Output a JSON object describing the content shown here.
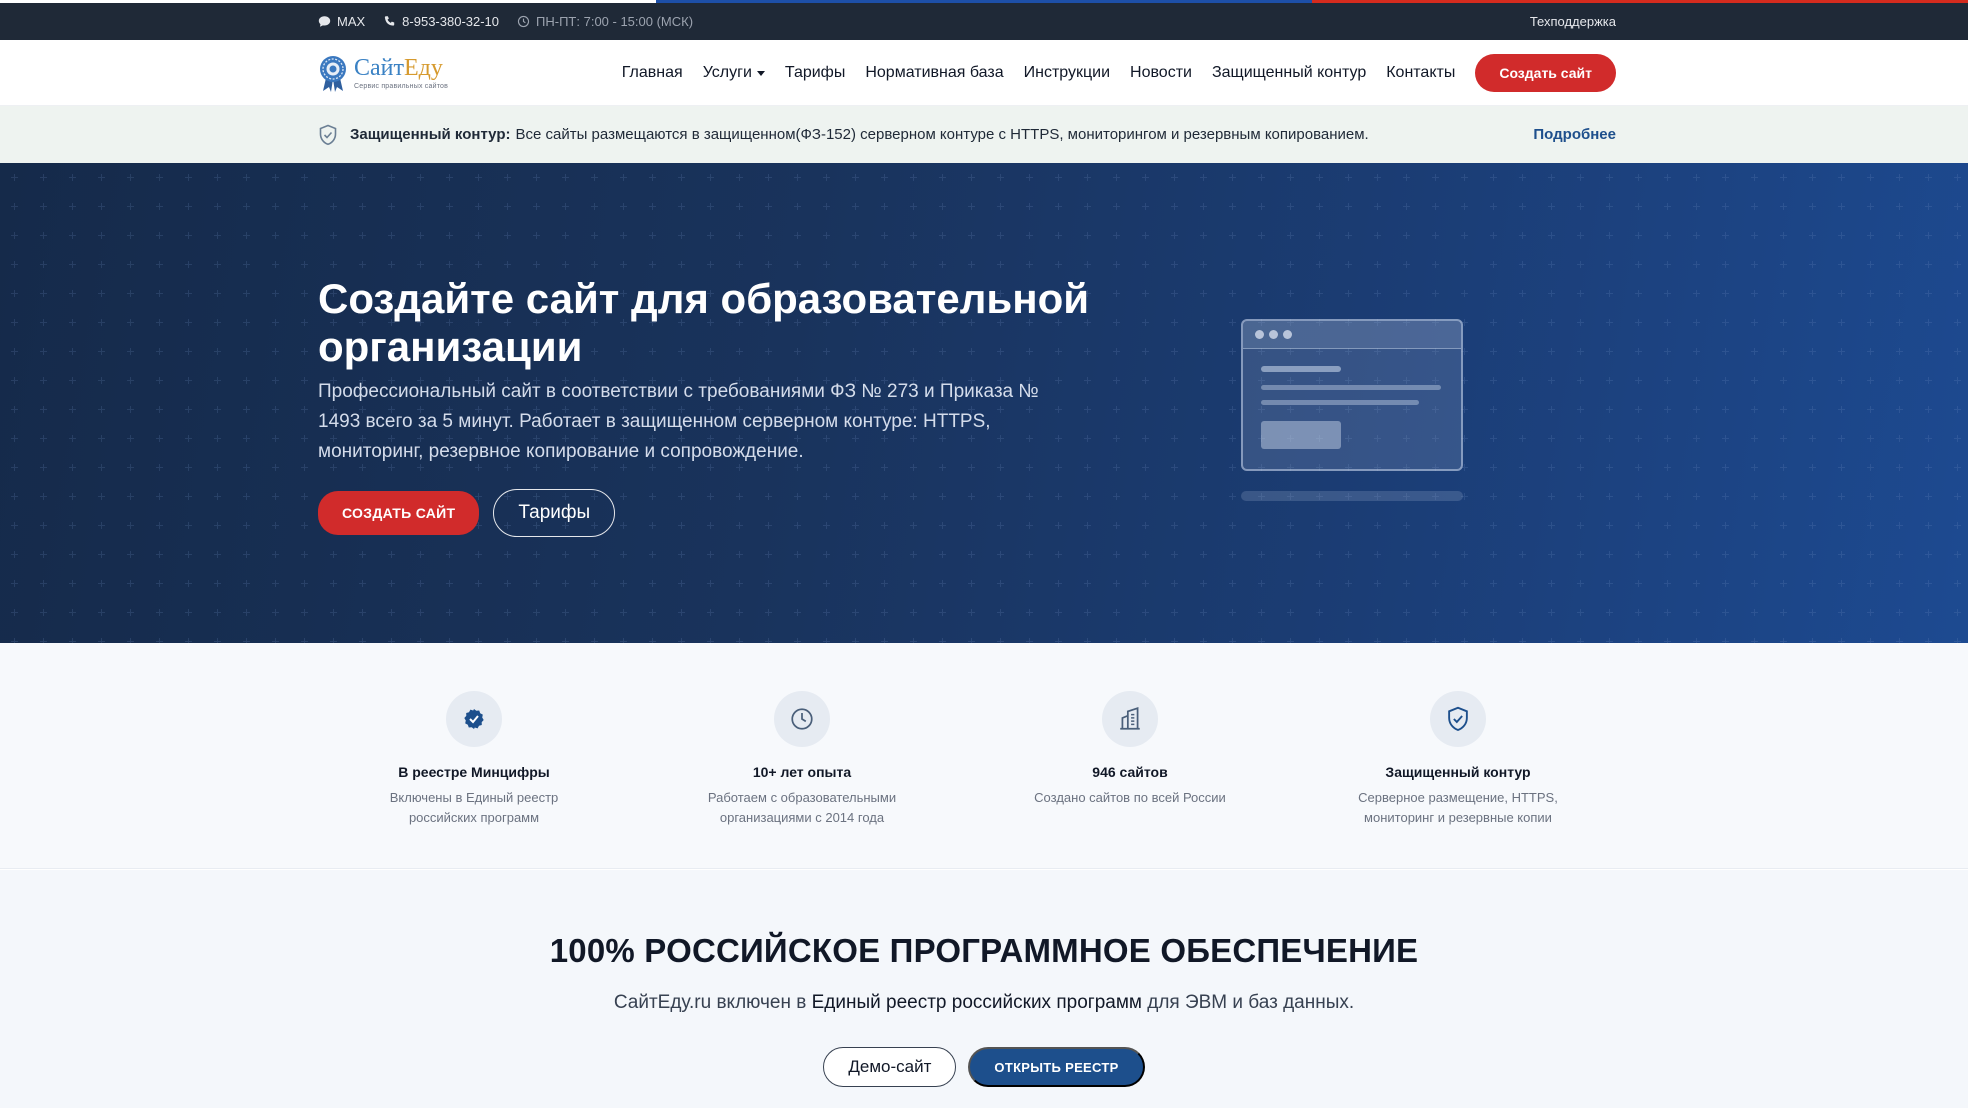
{
  "topbar": {
    "messenger": "MAX",
    "phone": "8-953-380-32-10",
    "hours": "ПН-ПТ: 7:00 - 15:00 (МСК)",
    "support": "Техподдержка"
  },
  "header": {
    "logo_name_a": "Сайт",
    "logo_name_b": "Еду",
    "logo_tagline": "Сервис правильных сайтов",
    "nav": [
      {
        "label": "Главная"
      },
      {
        "label": "Услуги"
      },
      {
        "label": "Тарифы"
      },
      {
        "label": "Нормативная база"
      },
      {
        "label": "Инструкции"
      },
      {
        "label": "Новости"
      },
      {
        "label": "Защищенный контур"
      },
      {
        "label": "Контакты"
      }
    ],
    "cta": "Создать сайт"
  },
  "notice": {
    "title": "Защищенный контур:",
    "text": "Все сайты размещаются в защищенном(ФЗ-152) серверном контуре с HTTPS, мониторингом и резервным копированием.",
    "more": "Подробнее"
  },
  "hero": {
    "title": "Создайте сайт для образовательной организации",
    "subtitle": "Профессиональный сайт в соответствии с требованиями ФЗ № 273 и Приказа № 1493 всего за 5 минут. Работает в защищенном серверном контуре: HTTPS, мониторинг, резервное копирование и сопровождение.",
    "primary_button": "Создать сайт",
    "secondary_button": "Тарифы"
  },
  "features": [
    {
      "icon": "verified-badge-icon",
      "title": "В реестре Минцифры",
      "desc": "Включены в Единый реестр российских программ"
    },
    {
      "icon": "clock-icon",
      "title": "10+ лет опыта",
      "desc": "Работаем с образовательными организациями с 2014 года"
    },
    {
      "icon": "buildings-icon",
      "title": "946 сайтов",
      "desc": "Создано сайтов по всей России"
    },
    {
      "icon": "shield-check-icon",
      "title": "Защищенный контур",
      "desc": "Серверное размещение, HTTPS, мониторинг и резервные копии"
    }
  ],
  "registry": {
    "title": "100% РОССИЙСКОЕ ПРОГРАММНОЕ ОБЕСПЕЧЕНИЕ",
    "text_before": "СайтЕду.ru включен в",
    "text_strong": "Единый реестр российских программ",
    "text_after": "для ЭВМ и баз данных.",
    "demo_button": "Демо-сайт",
    "open_button": "Открыть реестр"
  },
  "colors": {
    "accent_red": "#d12b2b",
    "brand_blue": "#1d4f8c",
    "topbar_bg": "#1f2937",
    "hero_bg": "#19335c"
  }
}
